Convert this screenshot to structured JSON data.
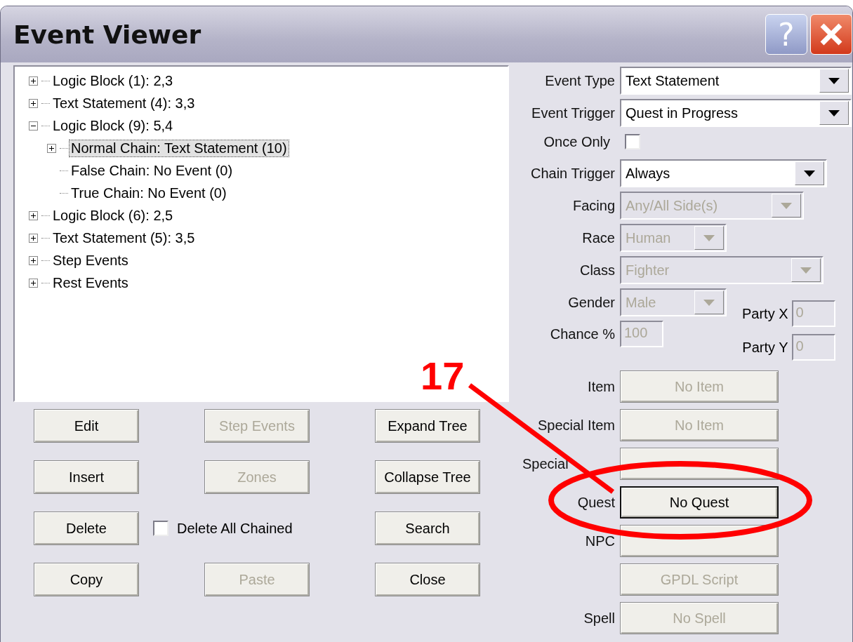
{
  "window": {
    "title": "Event Viewer",
    "help_button": "?"
  },
  "tree": [
    {
      "label": "Logic Block (1): 2,3",
      "expanded": false,
      "selected": false
    },
    {
      "label": "Text Statement (4): 3,3",
      "expanded": false,
      "selected": false
    },
    {
      "label": "Logic Block (9): 5,4",
      "expanded": true,
      "selected": false,
      "children": [
        {
          "label": "Normal Chain: Text Statement (10)",
          "expanded": false,
          "selected": true
        },
        {
          "label": "False Chain: No Event (0)",
          "selected": false
        },
        {
          "label": "True Chain: No Event (0)",
          "selected": false
        }
      ]
    },
    {
      "label": "Logic Block (6): 2,5",
      "expanded": false,
      "selected": false
    },
    {
      "label": "Text Statement (5): 3,5",
      "expanded": false,
      "selected": false
    },
    {
      "label": "Step Events",
      "expanded": false,
      "selected": false
    },
    {
      "label": "Rest Events",
      "expanded": false,
      "selected": false
    }
  ],
  "action_rows": [
    [
      {
        "kind": "button",
        "label": "Edit",
        "disabled": false
      },
      {
        "kind": "button",
        "label": "Step Events",
        "disabled": true
      },
      {
        "kind": "button",
        "label": "Expand Tree",
        "disabled": false
      }
    ],
    [
      {
        "kind": "button",
        "label": "Insert",
        "disabled": false
      },
      {
        "kind": "button",
        "label": "Zones",
        "disabled": true
      },
      {
        "kind": "button",
        "label": "Collapse Tree",
        "disabled": false
      }
    ],
    [
      {
        "kind": "button",
        "label": "Delete",
        "disabled": false
      },
      {
        "kind": "checkbox",
        "label": "Delete All Chained",
        "checked": false
      },
      {
        "kind": "button",
        "label": "Search",
        "disabled": false
      }
    ],
    [
      {
        "kind": "button",
        "label": "Copy",
        "disabled": false
      },
      {
        "kind": "button",
        "label": "Paste",
        "disabled": true
      },
      {
        "kind": "button",
        "label": "Close",
        "disabled": false
      }
    ]
  ],
  "properties": [
    {
      "kind": "dropdown",
      "label": "Event Type",
      "value": "Text Statement",
      "disabled": false
    },
    {
      "kind": "dropdown",
      "label": "Event Trigger",
      "value": "Quest in Progress",
      "disabled": false
    },
    {
      "kind": "checkbox",
      "label": "Once Only",
      "checked": false
    },
    {
      "kind": "dropdown",
      "label": "Chain Trigger",
      "value": "Always",
      "disabled": false
    },
    {
      "kind": "dropdown",
      "label": "Facing",
      "value": "Any/All Side(s)",
      "disabled": true
    },
    {
      "kind": "dropdown",
      "label": "Race",
      "value": "Human",
      "disabled": true
    },
    {
      "kind": "dropdown",
      "label": "Class",
      "value": "Fighter",
      "disabled": true
    }
  ],
  "gender": {
    "label": "Gender",
    "value": "Male",
    "disabled": true
  },
  "chance": {
    "label": "Chance %",
    "value": "100",
    "disabled": true
  },
  "party": [
    {
      "label": "Party X",
      "value": "0",
      "disabled": true
    },
    {
      "label": "Party Y",
      "value": "0",
      "disabled": true
    }
  ],
  "pickers": [
    {
      "label": "Item",
      "button": "No Item",
      "disabled": true
    },
    {
      "label": "Special Item",
      "button": "No Item",
      "disabled": true
    },
    {
      "label": "Special",
      "disabled": true
    },
    {
      "label": "Quest",
      "button": "No Quest",
      "disabled": false
    },
    {
      "label": "NPC",
      "disabled": true
    },
    {
      "button": "GPDL Script",
      "disabled": true
    },
    {
      "label": "Spell",
      "button": "No Spell",
      "disabled": true
    }
  ],
  "annotation": {
    "number": "17"
  }
}
